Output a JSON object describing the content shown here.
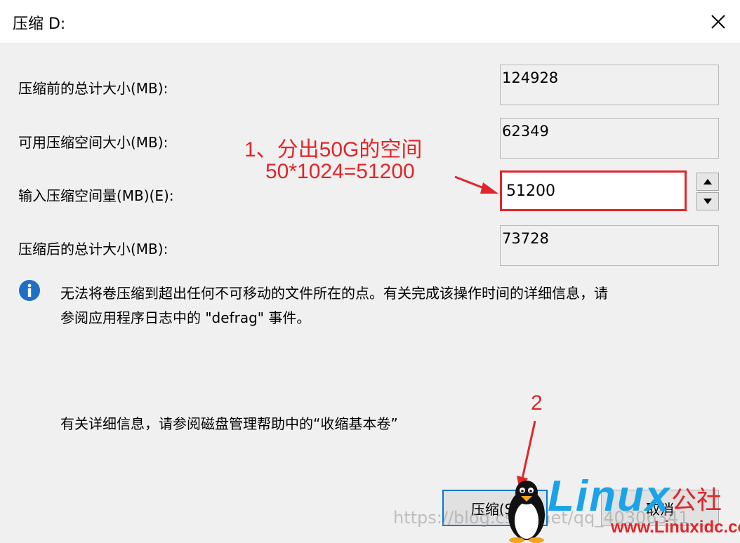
{
  "window": {
    "title": "压缩 D:"
  },
  "fields": {
    "total_before_label": "压缩前的总计大小(MB):",
    "total_before_value": "124928",
    "available_label": "可用压缩空间大小(MB):",
    "available_value": "62349",
    "shrink_amount_label": "输入压缩空间量(MB)(E):",
    "shrink_amount_value": "51200",
    "total_after_label": "压缩后的总计大小(MB):",
    "total_after_value": "73728"
  },
  "info": {
    "line1": "无法将卷压缩到超出任何不可移动的文件所在的点。有关完成该操作时间的详细信息，请",
    "line2": "参阅应用程序日志中的 \"defrag\" 事件。",
    "help_text": "有关详细信息，请参阅磁盘管理帮助中的“收缩基本卷”"
  },
  "annotations": {
    "step1_line1": "1、分出50G的空间",
    "step1_line2": "50*1024=51200",
    "step2": "2"
  },
  "buttons": {
    "shrink_label": "压缩(S)",
    "cancel_label": "取消"
  },
  "watermark": {
    "text": "https://blog.csdn.net/qq_40306341",
    "logo_text": "Linux",
    "logo_cn": "公社",
    "logo_url": "www.Linuxidc.com"
  },
  "colors": {
    "annotation_red": "#e0262a",
    "info_blue": "#1e6fc8",
    "logo_blue": "#1aa3e8"
  }
}
